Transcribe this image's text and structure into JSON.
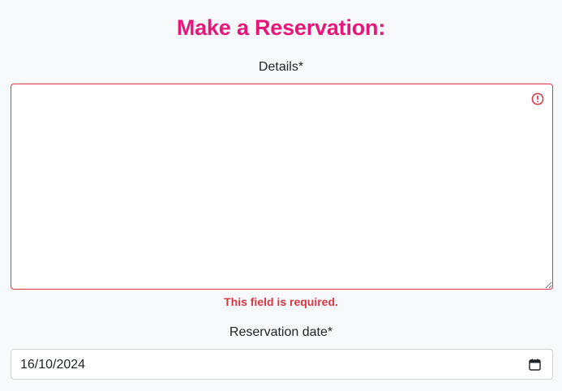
{
  "form": {
    "title": "Make a Reservation:",
    "details": {
      "label": "Details*",
      "value": "",
      "error": "This field is required.",
      "error_icon": "exclamation-circle-icon"
    },
    "reservation_date": {
      "label": "Reservation date*",
      "value": "16/10/2024",
      "icon": "calendar-icon"
    }
  },
  "colors": {
    "title": "#e6177a",
    "error": "#dc3545",
    "background": "#f8f9fa",
    "input_border": "#ced4da"
  }
}
